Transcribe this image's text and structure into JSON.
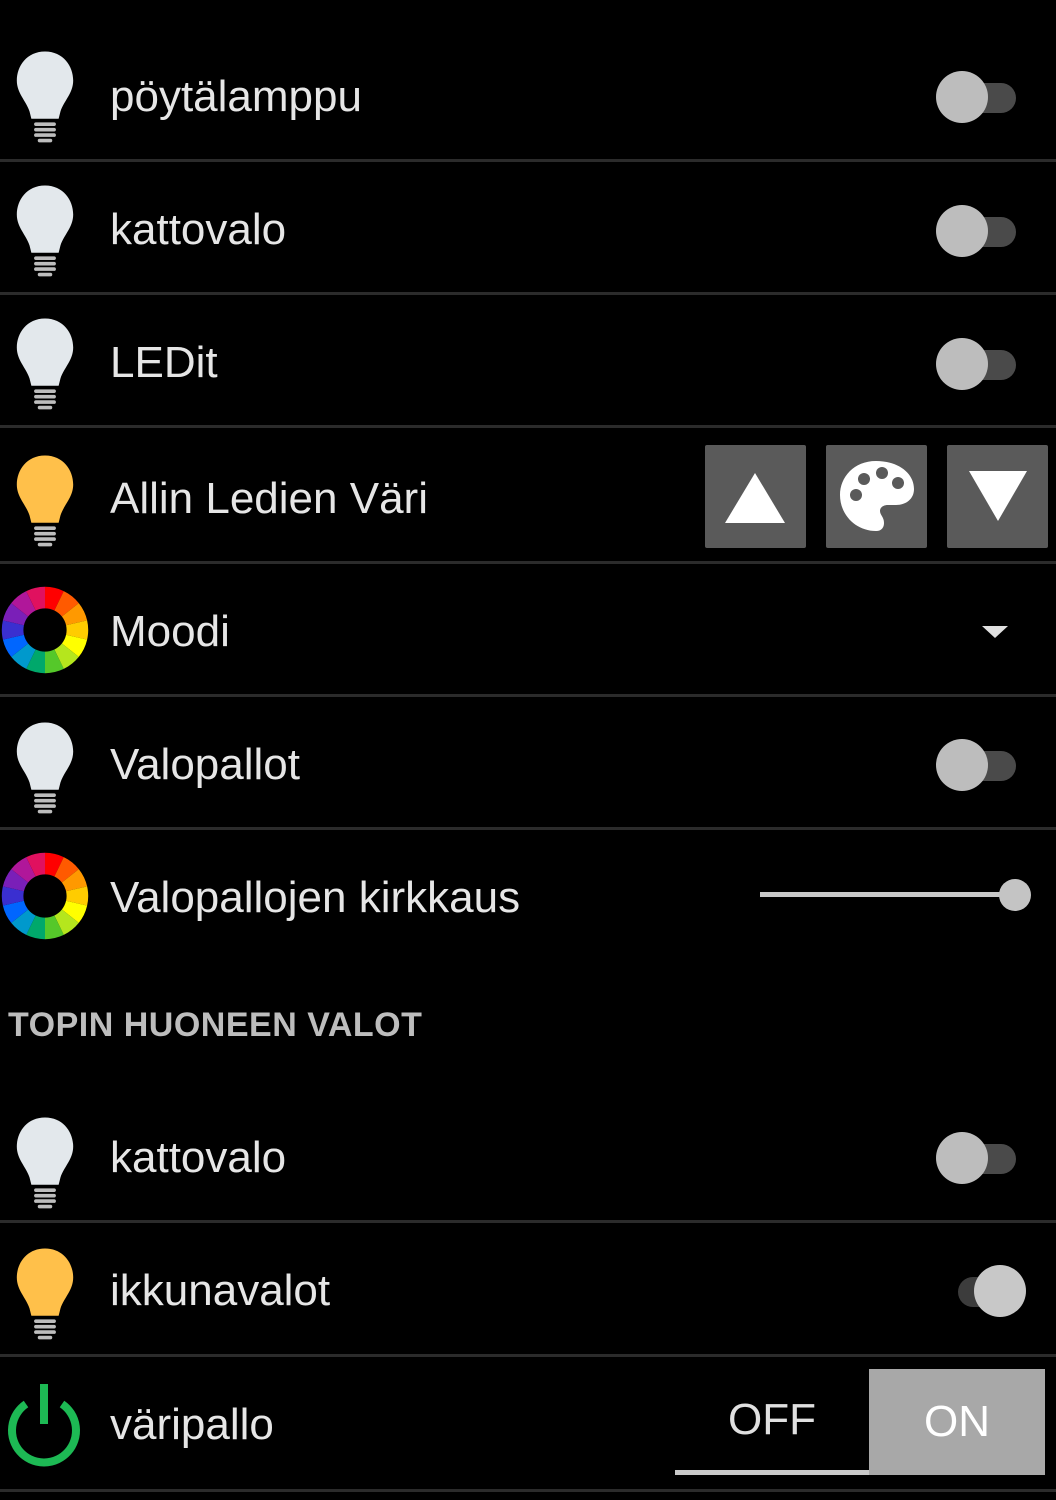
{
  "colors": {
    "bulb_off": "#e3e8ec",
    "bulb_on": "#ffc04a",
    "power_green": "#1db954",
    "switch_thumb": "#bdbdbd",
    "background": "#000000"
  },
  "rows": [
    {
      "label": "pöytälamppu",
      "icon": "bulb-off-icon",
      "control": "switch",
      "state": "off"
    },
    {
      "label": "kattovalo",
      "icon": "bulb-off-icon",
      "control": "switch",
      "state": "off"
    },
    {
      "label": "LEDit",
      "icon": "bulb-off-icon",
      "control": "switch",
      "state": "off"
    },
    {
      "label": "Allin Ledien Väri",
      "icon": "bulb-on-icon",
      "control": "buttons",
      "buttons": [
        "up-arrow-icon",
        "palette-icon",
        "down-arrow-icon"
      ]
    },
    {
      "label": "Moodi",
      "icon": "color-wheel-icon",
      "control": "dropdown"
    },
    {
      "label": "Valopallot",
      "icon": "bulb-off-icon",
      "control": "switch",
      "state": "off"
    },
    {
      "label": "Valopallojen kirkkaus",
      "icon": "color-wheel-icon",
      "control": "slider",
      "value_fraction": 1.0
    }
  ],
  "section": {
    "title": "TOPIN HUONEEN VALOT",
    "rows": [
      {
        "label": "kattovalo",
        "icon": "bulb-off-icon",
        "control": "switch",
        "state": "off"
      },
      {
        "label": "ikkunavalot",
        "icon": "bulb-on-icon",
        "control": "switch",
        "state": "on"
      },
      {
        "label": "väripallo",
        "icon": "power-icon",
        "control": "segmented",
        "options": [
          "OFF",
          "ON"
        ],
        "selected": "ON"
      }
    ]
  }
}
